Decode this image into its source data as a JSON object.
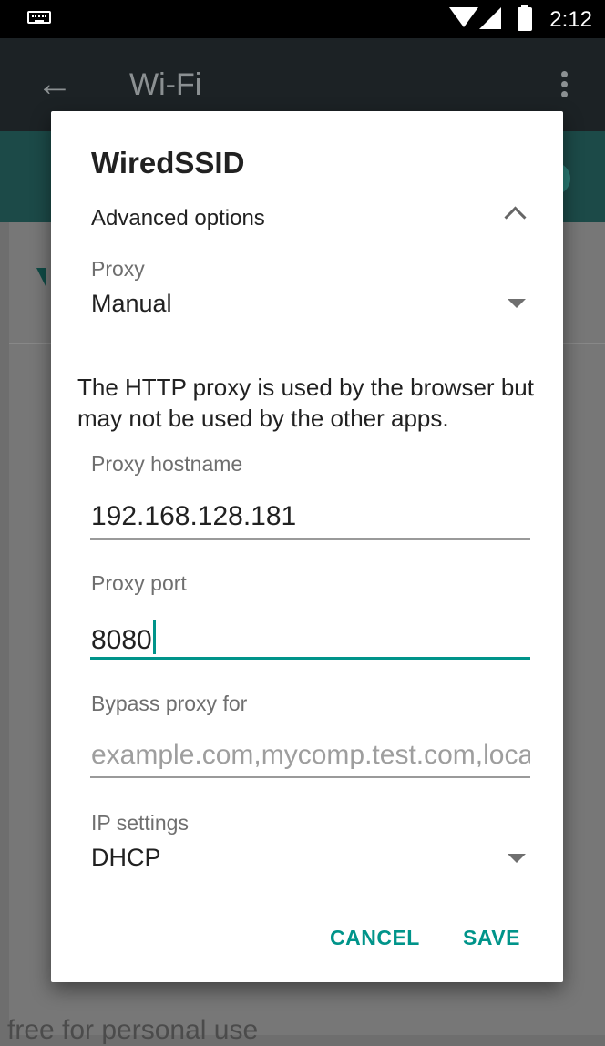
{
  "status_bar": {
    "time": "2:12"
  },
  "app_bar": {
    "title": "Wi-Fi"
  },
  "background": {
    "bottom_text": "free for personal use"
  },
  "dialog": {
    "title": "WiredSSID",
    "advanced_options_label": "Advanced options",
    "proxy": {
      "label": "Proxy",
      "value": "Manual"
    },
    "info_text": "The HTTP proxy is used by the browser but may not be used by the other apps.",
    "proxy_hostname": {
      "label": "Proxy hostname",
      "value": "192.168.128.181"
    },
    "proxy_port": {
      "label": "Proxy port",
      "value": "8080"
    },
    "bypass": {
      "label": "Bypass proxy for",
      "placeholder": "example.com,mycomp.test.com,localhost"
    },
    "ip_settings": {
      "label": "IP settings",
      "value": "DHCP"
    },
    "buttons": {
      "cancel": "CANCEL",
      "save": "SAVE"
    }
  },
  "colors": {
    "accent": "#00948a",
    "statusbar": "#000000",
    "appbar": "#1c2225"
  }
}
